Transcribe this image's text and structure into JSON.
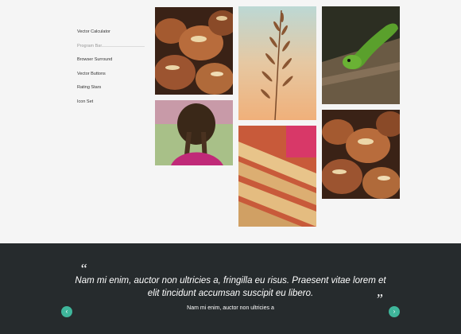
{
  "sidebar": {
    "items": [
      {
        "label": "Vector Calculator"
      },
      {
        "label": "Program Bar"
      },
      {
        "label": "Browser Surround"
      },
      {
        "label": "Vector Buttons"
      },
      {
        "label": "Rating Stars"
      },
      {
        "label": "Icon Set"
      }
    ],
    "active_index": 1
  },
  "gallery": {
    "photos": [
      {
        "name": "pastries-photo"
      },
      {
        "name": "wheat-photo"
      },
      {
        "name": "lizard-photo"
      },
      {
        "name": "girl-braids-photo"
      },
      {
        "name": "breadsticks-photo"
      },
      {
        "name": "pastries-photo-2"
      }
    ]
  },
  "testimonial": {
    "open_quote": "“",
    "close_quote": "”",
    "text": "Nam mi enim, auctor non ultricies a, fringilla eu risus. Praesent vitae lorem et elit tincidunt accumsan suscipit eu libero.",
    "author": "Nam mi enim, auctor non ultricies a",
    "prev_icon": "‹",
    "next_icon": "›"
  },
  "colors": {
    "footer_bg": "#262b2d",
    "accent": "#3fb69b",
    "page_bg": "#f5f5f5"
  }
}
